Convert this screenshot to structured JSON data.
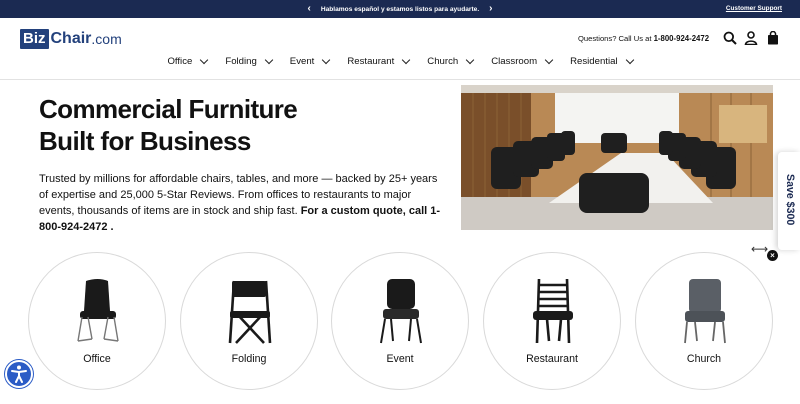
{
  "topbar": {
    "promo_text": "Hablamos español y estamos listos para ayudarte.",
    "support_link": "Customer Support"
  },
  "header": {
    "logo_biz": "Biz",
    "logo_chair": "Chair",
    "logo_com": ".com",
    "phone_label": "Questions? Call Us at",
    "phone_number": "1-800-924-2472"
  },
  "nav": {
    "items": [
      "Office",
      "Folding",
      "Event",
      "Restaurant",
      "Church",
      "Classroom",
      "Residential"
    ]
  },
  "hero": {
    "title_line1": "Commercial Furniture",
    "title_line2": "Built for Business",
    "body": "Trusted by millions for affordable chairs, tables, and more — backed by 25+ years of expertise and 25,000 5-Star Reviews. From offices to restaurants to major events, thousands of items are in stock and ship fast. ",
    "cta": "For a custom quote, call 1-800-924-2472 ."
  },
  "side_tab": {
    "label": "Save $300"
  },
  "categories": {
    "items": [
      {
        "label": "Office"
      },
      {
        "label": "Folding"
      },
      {
        "label": "Event"
      },
      {
        "label": "Restaurant"
      },
      {
        "label": "Church"
      }
    ]
  },
  "colors": {
    "brand_navy": "#1b2a52",
    "logo_blue": "#23417c",
    "accessibility_blue": "#2a5bc6"
  }
}
